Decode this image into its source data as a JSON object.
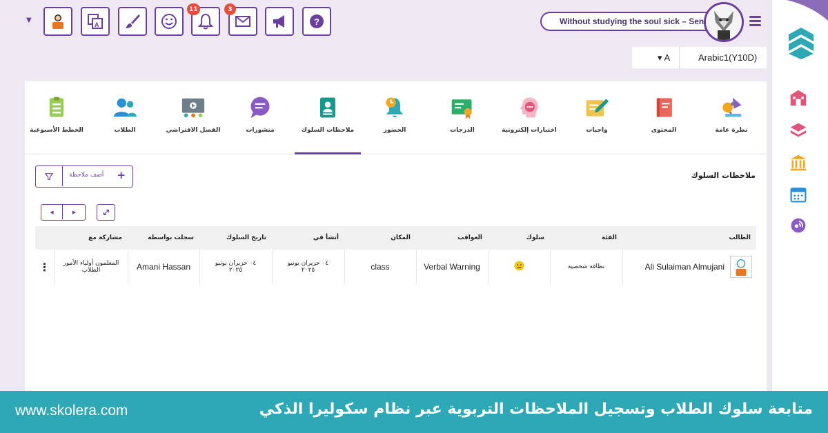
{
  "topbar": {
    "notifications_count": "11",
    "messages_count": "3",
    "quote": "Without studying the soul sick – Seneca"
  },
  "class_selector": {
    "level": "A",
    "class_name": "Arabic1(Y10D)"
  },
  "tabs": [
    {
      "id": "weekly-plans",
      "label": "الخطط الأسبوعية"
    },
    {
      "id": "students",
      "label": "الطلاب"
    },
    {
      "id": "virtual-class",
      "label": "الفصل الافتراضي"
    },
    {
      "id": "posts",
      "label": "منشورات"
    },
    {
      "id": "behavior-notes",
      "label": "ملاحظات السلوك",
      "active": true
    },
    {
      "id": "attendance",
      "label": "الحضور"
    },
    {
      "id": "grades",
      "label": "الدرجات"
    },
    {
      "id": "online-exams",
      "label": "اختبارات إلكترونية"
    },
    {
      "id": "assignments",
      "label": "واجبات"
    },
    {
      "id": "content",
      "label": "المحتوى"
    },
    {
      "id": "overview",
      "label": "نظرة عامة"
    }
  ],
  "section": {
    "title": "ملاحظات السلوك",
    "add_note": "أضف ملاحظة"
  },
  "table": {
    "headers": {
      "student": "الطالب",
      "category": "الفئة",
      "behavior": "سلوك",
      "consequence": "العواقب",
      "location": "المكان",
      "created": "أنشأ في",
      "behavior_date": "تاريخ السلوك",
      "recorded_by": "سجلت بواسطة",
      "shared_with": "مشاركة مع"
    },
    "rows": [
      {
        "student": "Ali Sulaiman Almujani",
        "category": "نظافة شخصية",
        "behavior_icon": "sad-face-icon",
        "consequence": "Verbal Warning",
        "location": "class",
        "created_line1": "٠٤ حزيران يونيو",
        "created_line2": "٢٠٢٥",
        "behavior_date_line1": "٠٤ حزيران يونيو",
        "behavior_date_line2": "٢٠٢٥",
        "recorded_by": "Amani Hassan",
        "shared_with": "المعلمون أولياء الأمور الطلاب"
      }
    ]
  },
  "banner": {
    "site": "www.skolera.com",
    "headline": "متابعة سلوك الطلاب وتسجيل الملاحظات التربوية عبر نظام سكوليرا الذكي"
  },
  "colors": {
    "accent": "#6b3fa0",
    "banner": "#2fa8b5",
    "sidebar_icons": "#e2557a"
  }
}
